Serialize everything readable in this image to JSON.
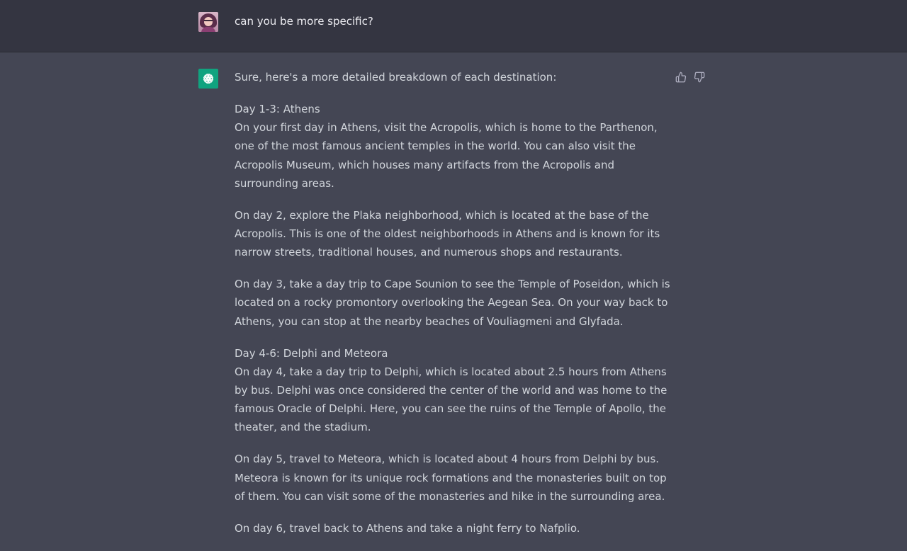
{
  "user_message": {
    "text": "can you be more specific?"
  },
  "assistant_message": {
    "intro": "Sure, here's a more detailed breakdown of each destination:",
    "sections": [
      {
        "heading": "Day 1-3: Athens",
        "paragraphs": [
          "On your first day in Athens, visit the Acropolis, which is home to the Parthenon, one of the most famous ancient temples in the world. You can also visit the Acropolis Museum, which houses many artifacts from the Acropolis and surrounding areas.",
          "On day 2, explore the Plaka neighborhood, which is located at the base of the Acropolis. This is one of the oldest neighborhoods in Athens and is known for its narrow streets, traditional houses, and numerous shops and restaurants.",
          "On day 3, take a day trip to Cape Sounion to see the Temple of Poseidon, which is located on a rocky promontory overlooking the Aegean Sea. On your way back to Athens, you can stop at the nearby beaches of Vouliagmeni and Glyfada."
        ]
      },
      {
        "heading": "Day 4-6: Delphi and Meteora",
        "paragraphs": [
          "On day 4, take a day trip to Delphi, which is located about 2.5 hours from Athens by bus. Delphi was once considered the center of the world and was home to the famous Oracle of Delphi. Here, you can see the ruins of the Temple of Apollo, the theater, and the stadium.",
          "On day 5, travel to Meteora, which is located about 4 hours from Delphi by bus. Meteora is known for its unique rock formations and the monasteries built on top of them. You can visit some of the monasteries and hike in the surrounding area.",
          "On day 6, travel back to Athens and take a night ferry to Nafplio."
        ]
      }
    ]
  },
  "icons": {
    "user_avatar": "user-avatar",
    "assistant_avatar": "openai-logo-icon",
    "thumb_up": "thumbs-up-icon",
    "thumb_down": "thumbs-down-icon"
  },
  "colors": {
    "user_row_bg": "#343541",
    "assistant_row_bg": "#444654",
    "bot_avatar_bg": "#10a37f"
  }
}
